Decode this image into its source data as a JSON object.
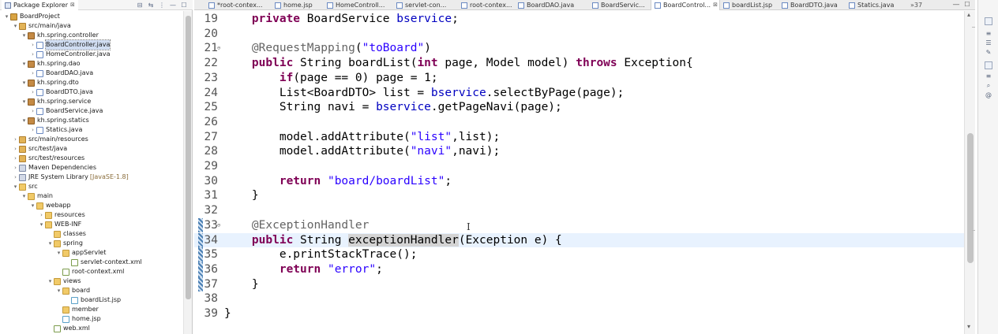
{
  "package_explorer": {
    "title": "Package Explorer",
    "tab_close": "⊠",
    "tools": [
      "⊟",
      "⇆",
      "⋮",
      "—",
      "☐"
    ],
    "tree": [
      {
        "label": "BoardProject",
        "depth": 0,
        "twist": "▾",
        "icon": "project"
      },
      {
        "label": "src/main/java",
        "depth": 1,
        "twist": "▾",
        "icon": "srcfolder"
      },
      {
        "label": "kh.spring.controller",
        "depth": 2,
        "twist": "▾",
        "icon": "package"
      },
      {
        "label": "BoardController.java",
        "depth": 3,
        "twist": "›",
        "icon": "java",
        "selected": true
      },
      {
        "label": "HomeController.java",
        "depth": 3,
        "twist": "›",
        "icon": "java"
      },
      {
        "label": "kh.spring.dao",
        "depth": 2,
        "twist": "▾",
        "icon": "package"
      },
      {
        "label": "BoardDAO.java",
        "depth": 3,
        "twist": "›",
        "icon": "java"
      },
      {
        "label": "kh.spring.dto",
        "depth": 2,
        "twist": "▾",
        "icon": "package"
      },
      {
        "label": "BoardDTO.java",
        "depth": 3,
        "twist": "›",
        "icon": "java"
      },
      {
        "label": "kh.spring.service",
        "depth": 2,
        "twist": "▾",
        "icon": "package"
      },
      {
        "label": "BoardService.java",
        "depth": 3,
        "twist": "›",
        "icon": "java"
      },
      {
        "label": "kh.spring.statics",
        "depth": 2,
        "twist": "▾",
        "icon": "package"
      },
      {
        "label": "Statics.java",
        "depth": 3,
        "twist": "›",
        "icon": "java"
      },
      {
        "label": "src/main/resources",
        "depth": 1,
        "twist": "›",
        "icon": "srcfolder"
      },
      {
        "label": "src/test/java",
        "depth": 1,
        "twist": "›",
        "icon": "srcfolder"
      },
      {
        "label": "src/test/resources",
        "depth": 1,
        "twist": "›",
        "icon": "srcfolder"
      },
      {
        "label": "Maven Dependencies",
        "depth": 1,
        "twist": "›",
        "icon": "lib"
      },
      {
        "label": "JRE System Library",
        "suffix": "[JavaSE-1.8]",
        "depth": 1,
        "twist": "›",
        "icon": "lib"
      },
      {
        "label": "src",
        "depth": 1,
        "twist": "▾",
        "icon": "folder"
      },
      {
        "label": "main",
        "depth": 2,
        "twist": "▾",
        "icon": "folder"
      },
      {
        "label": "webapp",
        "depth": 3,
        "twist": "▾",
        "icon": "folder"
      },
      {
        "label": "resources",
        "depth": 4,
        "twist": "›",
        "icon": "folder"
      },
      {
        "label": "WEB-INF",
        "depth": 4,
        "twist": "▾",
        "icon": "folder"
      },
      {
        "label": "classes",
        "depth": 5,
        "twist": "",
        "icon": "folder"
      },
      {
        "label": "spring",
        "depth": 5,
        "twist": "▾",
        "icon": "folder"
      },
      {
        "label": "appServlet",
        "depth": 6,
        "twist": "▾",
        "icon": "folder"
      },
      {
        "label": "servlet-context.xml",
        "depth": 7,
        "twist": "",
        "icon": "xml"
      },
      {
        "label": "root-context.xml",
        "depth": 6,
        "twist": "",
        "icon": "xml"
      },
      {
        "label": "views",
        "depth": 5,
        "twist": "▾",
        "icon": "folder"
      },
      {
        "label": "board",
        "depth": 6,
        "twist": "▾",
        "icon": "folder"
      },
      {
        "label": "boardList.jsp",
        "depth": 7,
        "twist": "",
        "icon": "jsp"
      },
      {
        "label": "member",
        "depth": 6,
        "twist": "",
        "icon": "folder"
      },
      {
        "label": "home.jsp",
        "depth": 6,
        "twist": "",
        "icon": "jsp"
      },
      {
        "label": "web.xml",
        "depth": 5,
        "twist": "",
        "icon": "xml"
      }
    ]
  },
  "editor": {
    "tabs": [
      {
        "label": "*root-contex..."
      },
      {
        "label": "home.jsp"
      },
      {
        "label": "HomeControll..."
      },
      {
        "label": "servlet-con..."
      },
      {
        "label": "root-contex..."
      },
      {
        "label": "BoardDAO.java"
      },
      {
        "label": "BoardServic..."
      },
      {
        "label": "BoardControl...",
        "active": true,
        "close": "⊠"
      },
      {
        "label": "boardList.jsp"
      },
      {
        "label": "BoardDTO.java"
      },
      {
        "label": "Statics.java"
      }
    ],
    "more_tabs": "»37",
    "window_controls": {
      "minimize": "—",
      "maximize": "☐"
    },
    "current_line": 34,
    "lines": [
      {
        "n": "19",
        "tokens": [
          [
            "",
            "    "
          ],
          [
            "k",
            "private"
          ],
          [
            "",
            " BoardService "
          ],
          [
            "f",
            "bservice"
          ],
          [
            "",
            ";"
          ]
        ]
      },
      {
        "n": "20",
        "tokens": []
      },
      {
        "n": "21",
        "fold": "⊖",
        "tokens": [
          [
            "",
            "    "
          ],
          [
            "a",
            "@RequestMapping"
          ],
          [
            "",
            "("
          ],
          [
            "s",
            "\"toBoard\""
          ],
          [
            "",
            ")"
          ]
        ]
      },
      {
        "n": "22",
        "tokens": [
          [
            "",
            "    "
          ],
          [
            "k",
            "public"
          ],
          [
            "",
            " String boardList("
          ],
          [
            "k",
            "int"
          ],
          [
            "",
            " page, Model model) "
          ],
          [
            "k",
            "throws"
          ],
          [
            "",
            " Exception{"
          ]
        ]
      },
      {
        "n": "23",
        "tokens": [
          [
            "",
            "        "
          ],
          [
            "k",
            "if"
          ],
          [
            "",
            "(page == 0) page = 1;"
          ]
        ]
      },
      {
        "n": "24",
        "tokens": [
          [
            "",
            "        List<BoardDTO> list = "
          ],
          [
            "f",
            "bservice"
          ],
          [
            "",
            ".selectByPage(page);"
          ]
        ]
      },
      {
        "n": "25",
        "tokens": [
          [
            "",
            "        String navi = "
          ],
          [
            "f",
            "bservice"
          ],
          [
            "",
            ".getPageNavi(page);"
          ]
        ]
      },
      {
        "n": "26",
        "tokens": []
      },
      {
        "n": "27",
        "tokens": [
          [
            "",
            "        model.addAttribute("
          ],
          [
            "s",
            "\"list\""
          ],
          [
            "",
            ",list);"
          ]
        ]
      },
      {
        "n": "28",
        "tokens": [
          [
            "",
            "        model.addAttribute("
          ],
          [
            "s",
            "\"navi\""
          ],
          [
            "",
            ",navi);"
          ]
        ]
      },
      {
        "n": "29",
        "tokens": []
      },
      {
        "n": "30",
        "tokens": [
          [
            "",
            "        "
          ],
          [
            "k",
            "return"
          ],
          [
            "",
            " "
          ],
          [
            "s",
            "\"board/boardList\""
          ],
          [
            "",
            ";"
          ]
        ]
      },
      {
        "n": "31",
        "tokens": [
          [
            "",
            "    }"
          ]
        ]
      },
      {
        "n": "32",
        "tokens": []
      },
      {
        "n": "33",
        "fold": "⊖",
        "marker": true,
        "tokens": [
          [
            "",
            "    "
          ],
          [
            "a",
            "@ExceptionHandler"
          ]
        ]
      },
      {
        "n": "34",
        "marker": true,
        "current": true,
        "tokens": [
          [
            "",
            "    "
          ],
          [
            "k",
            "public"
          ],
          [
            "",
            " String "
          ],
          [
            "hl",
            "exceptionHandler"
          ],
          [
            "",
            "(Exception e) {"
          ]
        ]
      },
      {
        "n": "35",
        "marker": true,
        "tokens": [
          [
            "",
            "        e.printStackTrace();"
          ]
        ]
      },
      {
        "n": "36",
        "marker": true,
        "tokens": [
          [
            "",
            "        "
          ],
          [
            "k",
            "return"
          ],
          [
            "",
            " "
          ],
          [
            "s",
            "\"error\""
          ],
          [
            "",
            ";"
          ]
        ]
      },
      {
        "n": "37",
        "marker": true,
        "tokens": [
          [
            "",
            "    }"
          ]
        ]
      },
      {
        "n": "38",
        "tokens": []
      },
      {
        "n": "39",
        "tokens": [
          [
            "",
            "}"
          ]
        ]
      }
    ],
    "ibeam": "I"
  },
  "colors": {
    "keyword": "#7f0055",
    "string": "#2a00ff",
    "field": "#0000c0",
    "annotation": "#646464",
    "current_line": "#e8f2fe",
    "selection": "#d0ddf2"
  },
  "right_toolbar": {
    "icons": [
      "restore-icon",
      "outline-icon",
      "task-list-icon",
      "type-hierarchy-icon",
      "console-icon",
      "problems-icon",
      "search-icon",
      "javadoc-icon"
    ]
  }
}
